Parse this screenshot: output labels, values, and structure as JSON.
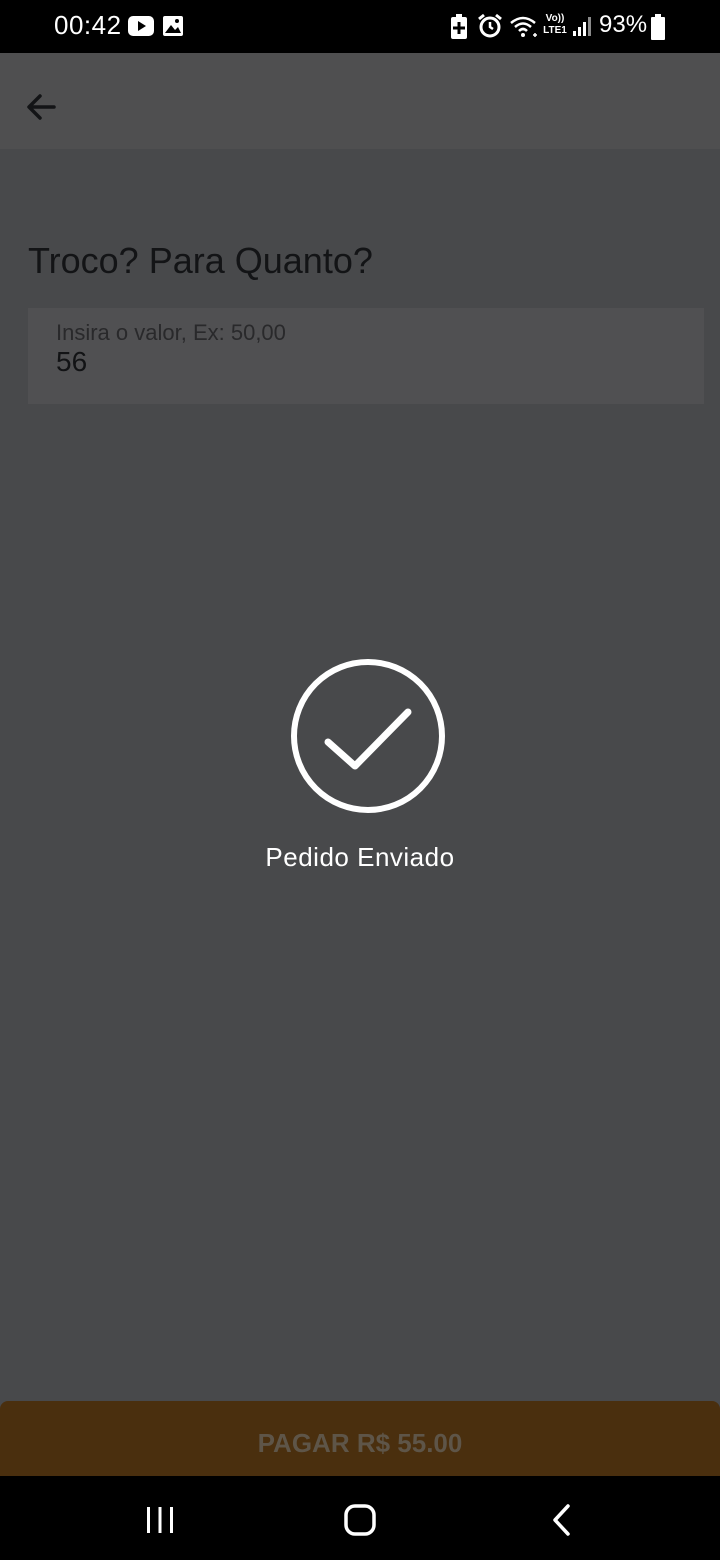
{
  "status_bar": {
    "time": "00:42",
    "battery": "93%",
    "icons": [
      "youtube-icon",
      "gallery-icon",
      "battery-saver-icon",
      "alarm-icon",
      "wifi-icon",
      "volte-icon",
      "signal-icon",
      "battery-icon"
    ],
    "network_label_top": "Vo))",
    "network_label_bottom": "LTE1"
  },
  "app_bar": {
    "back_icon": "arrow-left-icon"
  },
  "change_section": {
    "title": "Troco? Para Quanto?",
    "input_label": "Insira o valor, Ex: 50,00",
    "input_value": "56"
  },
  "success_overlay": {
    "icon": "check-circle-icon",
    "message": "Pedido Enviado"
  },
  "pay_button": {
    "label": "PAGAR R$ 55.00"
  },
  "nav_bar": {
    "buttons": [
      "recents-icon",
      "home-icon",
      "back-icon"
    ]
  },
  "colors": {
    "background": "#48494b",
    "app_bar": "#4f4f50",
    "pay_button": "#4a2f0e",
    "success": "#ffffff"
  }
}
